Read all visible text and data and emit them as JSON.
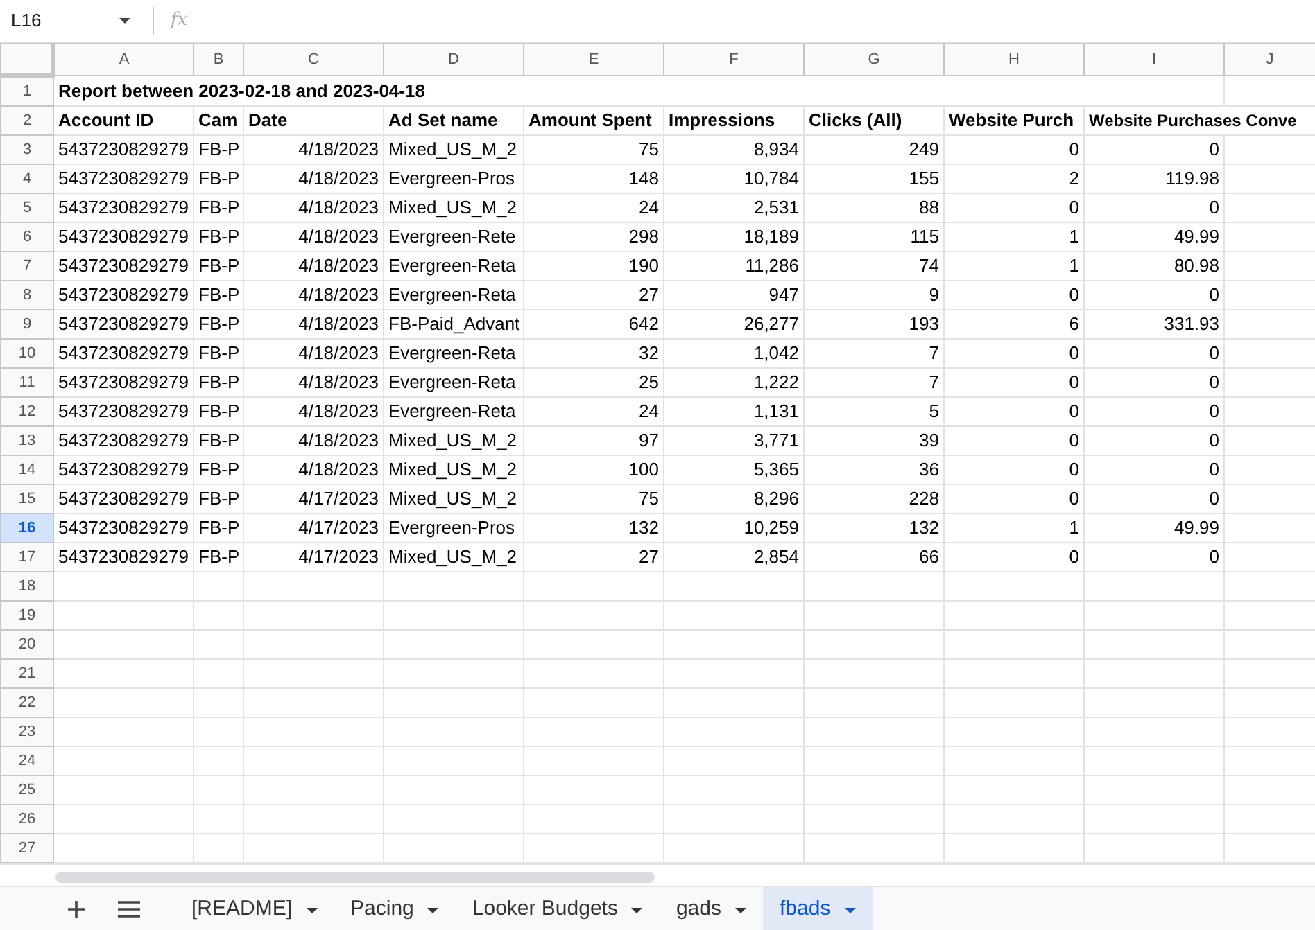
{
  "name_box": "L16",
  "formula_label": "fx",
  "columns": [
    "A",
    "B",
    "C",
    "D",
    "E",
    "F",
    "G",
    "H",
    "I",
    "J"
  ],
  "rows": [
    {
      "number": "1",
      "selected": false,
      "kind": "title",
      "title": "Report between 2023-02-18 and 2023-04-18"
    },
    {
      "number": "2",
      "selected": false,
      "kind": "header",
      "cells": [
        "Account ID",
        "Cam",
        "Date",
        "Ad Set name",
        "Amount Spent",
        "Impressions",
        "Clicks (All)",
        "Website Purch",
        "Website Purchases Conve"
      ]
    },
    {
      "number": "3",
      "selected": false,
      "kind": "data",
      "cells": [
        "5437230829279",
        "FB-P",
        "4/18/2023",
        "Mixed_US_M_2",
        "75",
        "8,934",
        "249",
        "0",
        "0"
      ]
    },
    {
      "number": "4",
      "selected": false,
      "kind": "data",
      "cells": [
        "5437230829279",
        "FB-P",
        "4/18/2023",
        "Evergreen-Pros",
        "148",
        "10,784",
        "155",
        "2",
        "119.98"
      ]
    },
    {
      "number": "5",
      "selected": false,
      "kind": "data",
      "cells": [
        "5437230829279",
        "FB-P",
        "4/18/2023",
        "Mixed_US_M_2",
        "24",
        "2,531",
        "88",
        "0",
        "0"
      ]
    },
    {
      "number": "6",
      "selected": false,
      "kind": "data",
      "cells": [
        "5437230829279",
        "FB-P",
        "4/18/2023",
        "Evergreen-Rete",
        "298",
        "18,189",
        "115",
        "1",
        "49.99"
      ]
    },
    {
      "number": "7",
      "selected": false,
      "kind": "data",
      "cells": [
        "5437230829279",
        "FB-P",
        "4/18/2023",
        "Evergreen-Reta",
        "190",
        "11,286",
        "74",
        "1",
        "80.98"
      ]
    },
    {
      "number": "8",
      "selected": false,
      "kind": "data",
      "cells": [
        "5437230829279",
        "FB-P",
        "4/18/2023",
        "Evergreen-Reta",
        "27",
        "947",
        "9",
        "0",
        "0"
      ]
    },
    {
      "number": "9",
      "selected": false,
      "kind": "data",
      "cells": [
        "5437230829279",
        "FB-P",
        "4/18/2023",
        "FB-Paid_Advant",
        "642",
        "26,277",
        "193",
        "6",
        "331.93"
      ]
    },
    {
      "number": "10",
      "selected": false,
      "kind": "data",
      "cells": [
        "5437230829279",
        "FB-P",
        "4/18/2023",
        "Evergreen-Reta",
        "32",
        "1,042",
        "7",
        "0",
        "0"
      ]
    },
    {
      "number": "11",
      "selected": false,
      "kind": "data",
      "cells": [
        "5437230829279",
        "FB-P",
        "4/18/2023",
        "Evergreen-Reta",
        "25",
        "1,222",
        "7",
        "0",
        "0"
      ]
    },
    {
      "number": "12",
      "selected": false,
      "kind": "data",
      "cells": [
        "5437230829279",
        "FB-P",
        "4/18/2023",
        "Evergreen-Reta",
        "24",
        "1,131",
        "5",
        "0",
        "0"
      ]
    },
    {
      "number": "13",
      "selected": false,
      "kind": "data",
      "cells": [
        "5437230829279",
        "FB-P",
        "4/18/2023",
        "Mixed_US_M_2",
        "97",
        "3,771",
        "39",
        "0",
        "0"
      ]
    },
    {
      "number": "14",
      "selected": false,
      "kind": "data",
      "cells": [
        "5437230829279",
        "FB-P",
        "4/18/2023",
        "Mixed_US_M_2",
        "100",
        "5,365",
        "36",
        "0",
        "0"
      ]
    },
    {
      "number": "15",
      "selected": false,
      "kind": "data",
      "cells": [
        "5437230829279",
        "FB-P",
        "4/17/2023",
        "Mixed_US_M_2",
        "75",
        "8,296",
        "228",
        "0",
        "0"
      ]
    },
    {
      "number": "16",
      "selected": true,
      "kind": "data",
      "cells": [
        "5437230829279",
        "FB-P",
        "4/17/2023",
        "Evergreen-Pros",
        "132",
        "10,259",
        "132",
        "1",
        "49.99"
      ]
    },
    {
      "number": "17",
      "selected": false,
      "kind": "data",
      "cells": [
        "5437230829279",
        "FB-P",
        "4/17/2023",
        "Mixed_US_M_2",
        "27",
        "2,854",
        "66",
        "0",
        "0"
      ]
    },
    {
      "number": "18",
      "selected": false,
      "kind": "empty"
    },
    {
      "number": "19",
      "selected": false,
      "kind": "empty"
    },
    {
      "number": "20",
      "selected": false,
      "kind": "empty"
    },
    {
      "number": "21",
      "selected": false,
      "kind": "empty"
    },
    {
      "number": "22",
      "selected": false,
      "kind": "empty"
    },
    {
      "number": "23",
      "selected": false,
      "kind": "empty"
    },
    {
      "number": "24",
      "selected": false,
      "kind": "empty"
    },
    {
      "number": "25",
      "selected": false,
      "kind": "empty"
    },
    {
      "number": "26",
      "selected": false,
      "kind": "empty"
    },
    {
      "number": "27",
      "selected": false,
      "kind": "empty"
    }
  ],
  "sheet_tabs": [
    {
      "label": "[README]",
      "selected": false
    },
    {
      "label": "Pacing",
      "selected": false
    },
    {
      "label": "Looker Budgets",
      "selected": false
    },
    {
      "label": "gads",
      "selected": false
    },
    {
      "label": "fbads",
      "selected": true
    }
  ]
}
